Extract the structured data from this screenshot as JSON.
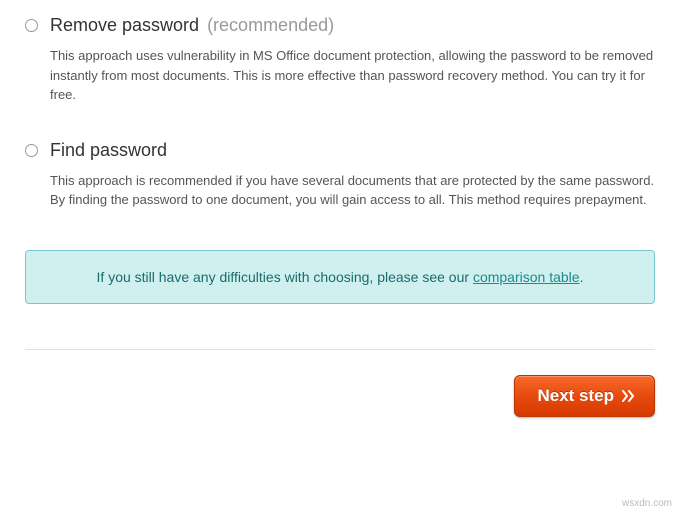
{
  "options": [
    {
      "title": "Remove password",
      "hint": "(recommended)",
      "description": "This approach uses vulnerability in MS Office document protection, allowing the password to be removed instantly from most documents. This is more effective than password recovery method. You can try it for free."
    },
    {
      "title": "Find password",
      "hint": "",
      "description": "This approach is recommended if you have several documents that are protected by the same password. By finding the password to one document, you will gain access to all. This method requires prepayment."
    }
  ],
  "info": {
    "prefix": "If you still have any difficulties with choosing, please see our ",
    "link": "comparison table",
    "suffix": "."
  },
  "button": {
    "label": "Next step"
  },
  "watermark": "wsxdn.com"
}
